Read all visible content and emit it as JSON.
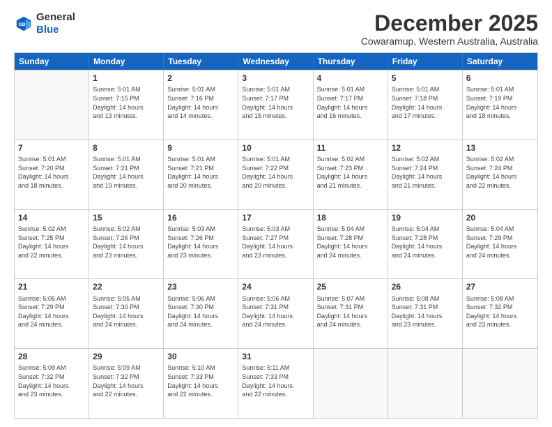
{
  "logo": {
    "line1": "General",
    "line2": "Blue"
  },
  "title": "December 2025",
  "subtitle": "Cowaramup, Western Australia, Australia",
  "header_days": [
    "Sunday",
    "Monday",
    "Tuesday",
    "Wednesday",
    "Thursday",
    "Friday",
    "Saturday"
  ],
  "weeks": [
    [
      {
        "day": "",
        "info": ""
      },
      {
        "day": "1",
        "info": "Sunrise: 5:01 AM\nSunset: 7:15 PM\nDaylight: 14 hours\nand 13 minutes."
      },
      {
        "day": "2",
        "info": "Sunrise: 5:01 AM\nSunset: 7:16 PM\nDaylight: 14 hours\nand 14 minutes."
      },
      {
        "day": "3",
        "info": "Sunrise: 5:01 AM\nSunset: 7:17 PM\nDaylight: 14 hours\nand 15 minutes."
      },
      {
        "day": "4",
        "info": "Sunrise: 5:01 AM\nSunset: 7:17 PM\nDaylight: 14 hours\nand 16 minutes."
      },
      {
        "day": "5",
        "info": "Sunrise: 5:01 AM\nSunset: 7:18 PM\nDaylight: 14 hours\nand 17 minutes."
      },
      {
        "day": "6",
        "info": "Sunrise: 5:01 AM\nSunset: 7:19 PM\nDaylight: 14 hours\nand 18 minutes."
      }
    ],
    [
      {
        "day": "7",
        "info": "Sunrise: 5:01 AM\nSunset: 7:20 PM\nDaylight: 14 hours\nand 18 minutes."
      },
      {
        "day": "8",
        "info": "Sunrise: 5:01 AM\nSunset: 7:21 PM\nDaylight: 14 hours\nand 19 minutes."
      },
      {
        "day": "9",
        "info": "Sunrise: 5:01 AM\nSunset: 7:21 PM\nDaylight: 14 hours\nand 20 minutes."
      },
      {
        "day": "10",
        "info": "Sunrise: 5:01 AM\nSunset: 7:22 PM\nDaylight: 14 hours\nand 20 minutes."
      },
      {
        "day": "11",
        "info": "Sunrise: 5:02 AM\nSunset: 7:23 PM\nDaylight: 14 hours\nand 21 minutes."
      },
      {
        "day": "12",
        "info": "Sunrise: 5:02 AM\nSunset: 7:24 PM\nDaylight: 14 hours\nand 21 minutes."
      },
      {
        "day": "13",
        "info": "Sunrise: 5:02 AM\nSunset: 7:24 PM\nDaylight: 14 hours\nand 22 minutes."
      }
    ],
    [
      {
        "day": "14",
        "info": "Sunrise: 5:02 AM\nSunset: 7:25 PM\nDaylight: 14 hours\nand 22 minutes."
      },
      {
        "day": "15",
        "info": "Sunrise: 5:02 AM\nSunset: 7:26 PM\nDaylight: 14 hours\nand 23 minutes."
      },
      {
        "day": "16",
        "info": "Sunrise: 5:03 AM\nSunset: 7:26 PM\nDaylight: 14 hours\nand 23 minutes."
      },
      {
        "day": "17",
        "info": "Sunrise: 5:03 AM\nSunset: 7:27 PM\nDaylight: 14 hours\nand 23 minutes."
      },
      {
        "day": "18",
        "info": "Sunrise: 5:04 AM\nSunset: 7:28 PM\nDaylight: 14 hours\nand 24 minutes."
      },
      {
        "day": "19",
        "info": "Sunrise: 5:04 AM\nSunset: 7:28 PM\nDaylight: 14 hours\nand 24 minutes."
      },
      {
        "day": "20",
        "info": "Sunrise: 5:04 AM\nSunset: 7:29 PM\nDaylight: 14 hours\nand 24 minutes."
      }
    ],
    [
      {
        "day": "21",
        "info": "Sunrise: 5:05 AM\nSunset: 7:29 PM\nDaylight: 14 hours\nand 24 minutes."
      },
      {
        "day": "22",
        "info": "Sunrise: 5:05 AM\nSunset: 7:30 PM\nDaylight: 14 hours\nand 24 minutes."
      },
      {
        "day": "23",
        "info": "Sunrise: 5:06 AM\nSunset: 7:30 PM\nDaylight: 14 hours\nand 24 minutes."
      },
      {
        "day": "24",
        "info": "Sunrise: 5:06 AM\nSunset: 7:31 PM\nDaylight: 14 hours\nand 24 minutes."
      },
      {
        "day": "25",
        "info": "Sunrise: 5:07 AM\nSunset: 7:31 PM\nDaylight: 14 hours\nand 24 minutes."
      },
      {
        "day": "26",
        "info": "Sunrise: 5:08 AM\nSunset: 7:31 PM\nDaylight: 14 hours\nand 23 minutes."
      },
      {
        "day": "27",
        "info": "Sunrise: 5:08 AM\nSunset: 7:32 PM\nDaylight: 14 hours\nand 23 minutes."
      }
    ],
    [
      {
        "day": "28",
        "info": "Sunrise: 5:09 AM\nSunset: 7:32 PM\nDaylight: 14 hours\nand 23 minutes."
      },
      {
        "day": "29",
        "info": "Sunrise: 5:09 AM\nSunset: 7:32 PM\nDaylight: 14 hours\nand 22 minutes."
      },
      {
        "day": "30",
        "info": "Sunrise: 5:10 AM\nSunset: 7:33 PM\nDaylight: 14 hours\nand 22 minutes."
      },
      {
        "day": "31",
        "info": "Sunrise: 5:11 AM\nSunset: 7:33 PM\nDaylight: 14 hours\nand 22 minutes."
      },
      {
        "day": "",
        "info": ""
      },
      {
        "day": "",
        "info": ""
      },
      {
        "day": "",
        "info": ""
      }
    ]
  ]
}
